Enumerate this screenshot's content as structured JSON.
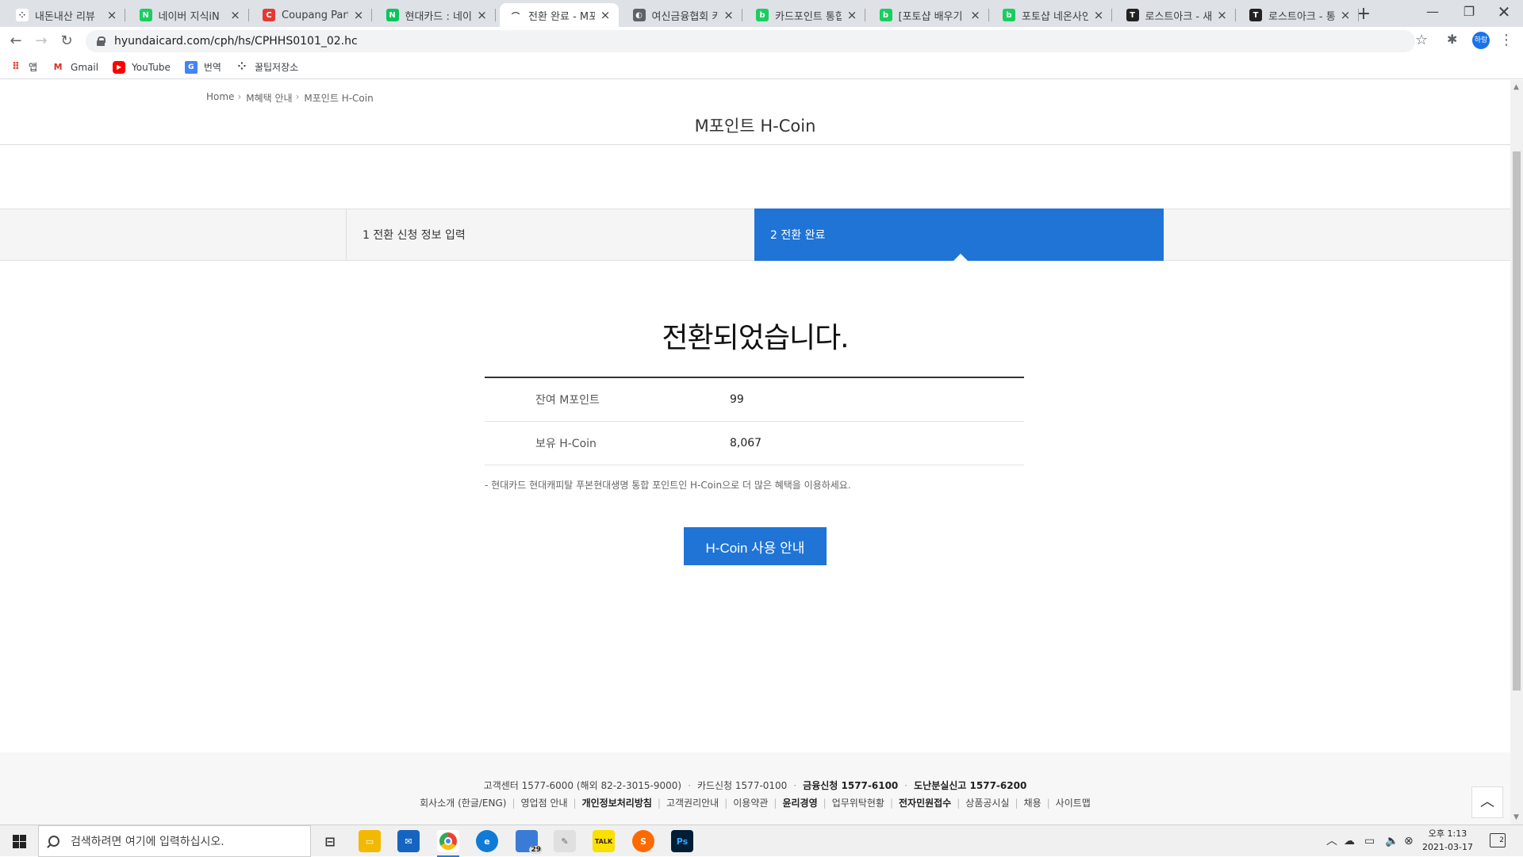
{
  "browser": {
    "tabs": [
      {
        "title": "내돈내산 리뷰",
        "fav_color": "#ffffff",
        "fav_text": "⁘"
      },
      {
        "title": "네이버 지식iN",
        "fav_color": "#19ce60",
        "fav_text": "N"
      },
      {
        "title": "Coupang Partne",
        "fav_color": "#e53935",
        "fav_text": "C"
      },
      {
        "title": "현대카드 : 네이",
        "fav_color": "#03c75a",
        "fav_text": "N"
      },
      {
        "title": "전환 완료 - M포",
        "fav_color": "#ffffff",
        "fav_text": "⌒"
      },
      {
        "title": "여신금융협회 카",
        "fav_color": "#5f6368",
        "fav_text": "◐"
      },
      {
        "title": "카드포인트 통합",
        "fav_color": "#19ce60",
        "fav_text": "b"
      },
      {
        "title": "[포토샵 배우기",
        "fav_color": "#19ce60",
        "fav_text": "b"
      },
      {
        "title": "포토샵 네온사인",
        "fav_color": "#19ce60",
        "fav_text": "b"
      },
      {
        "title": "로스트아크 - 새",
        "fav_color": "#222222",
        "fav_text": "T"
      },
      {
        "title": "로스트아크 - 통",
        "fav_color": "#222222",
        "fav_text": "T"
      }
    ],
    "active_tab": 4,
    "url": "hyundaicard.com/cph/hs/CPHHS0101_02.hc",
    "bookmarks": [
      {
        "label": "앱",
        "icon": "apps-icon"
      },
      {
        "label": "Gmail",
        "icon": "gmail-icon"
      },
      {
        "label": "YouTube",
        "icon": "youtube-icon"
      },
      {
        "label": "번역",
        "icon": "translate-icon"
      },
      {
        "label": "꿀팁저장소",
        "icon": "bookmark-icon"
      }
    ],
    "profile_label": "하랑"
  },
  "page": {
    "breadcrumb": [
      "Home",
      "M혜택 안내",
      "M포인트 H-Coin"
    ],
    "title": "M포인트 H-Coin",
    "steps": [
      {
        "label": "1 전환 신청 정보 입력",
        "active": false
      },
      {
        "label": "2 전환 완료",
        "active": true
      }
    ],
    "done_message": "전환되었습니다.",
    "results": [
      {
        "label": "잔여 M포인트",
        "value": "99"
      },
      {
        "label": "보유 H-Coin",
        "value": "8,067"
      }
    ],
    "note": "- 현대카드 현대캐피탈 푸본현대생명 통합 포인트인 H-Coin으로 더 많은 혜택을 이용하세요.",
    "cta_label": "H-Coin 사용 안내",
    "accent_color": "#1f74d6"
  },
  "footer": {
    "contacts": [
      {
        "text": "고객센터 1577-6000 (해외 82-2-3015-9000)",
        "bold": false
      },
      {
        "text": "카드신청 1577-0100",
        "bold": false
      },
      {
        "text": "금융신청 1577-6100",
        "bold": true
      },
      {
        "text": "도난분실신고 1577-6200",
        "bold": true
      }
    ],
    "links": [
      {
        "text": "회사소개 (한글/ENG)",
        "bold": false
      },
      {
        "text": "영업점 안내",
        "bold": false
      },
      {
        "text": "개인정보처리방침",
        "bold": true
      },
      {
        "text": "고객권리안내",
        "bold": false
      },
      {
        "text": "이용약관",
        "bold": false
      },
      {
        "text": "윤리경영",
        "bold": true
      },
      {
        "text": "업무위탁현황",
        "bold": false
      },
      {
        "text": "전자민원접수",
        "bold": true
      },
      {
        "text": "상품공시실",
        "bold": false
      },
      {
        "text": "채용",
        "bold": false
      },
      {
        "text": "사이트맵",
        "bold": false
      }
    ]
  },
  "taskbar": {
    "search_placeholder": "검색하려면 여기에 입력하십시오.",
    "clock_time": "오후 1:13",
    "clock_date": "2021-03-17",
    "notification_count": "2",
    "badge_count": "29"
  }
}
